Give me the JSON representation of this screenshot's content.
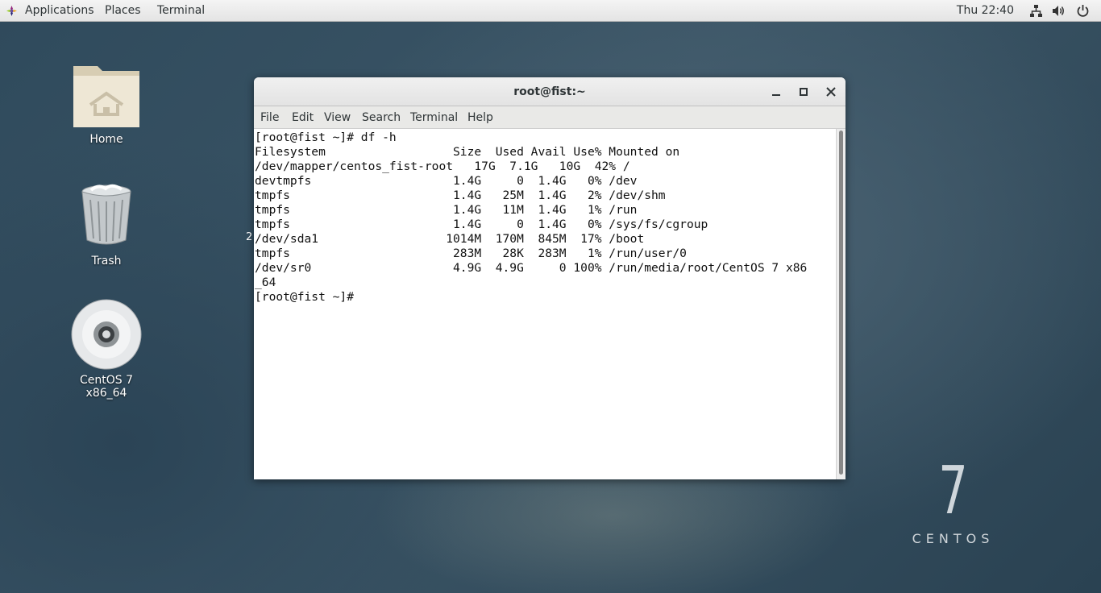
{
  "topbar": {
    "applications": "Applications",
    "places": "Places",
    "terminal": "Terminal",
    "clock": "Thu 22:40",
    "tray_icons": [
      "network-icon",
      "volume-icon",
      "power-icon"
    ]
  },
  "desktop": {
    "home_label": "Home",
    "trash_label": "Trash",
    "disc_label": "CentOS 7 x86_64",
    "stray_char": "2",
    "logo_number": "7",
    "logo_word": "CENTOS"
  },
  "window": {
    "title": "root@fist:~",
    "menu": [
      "File",
      "Edit",
      "View",
      "Search",
      "Terminal",
      "Help"
    ],
    "terminal_lines": [
      "[root@fist ~]# df -h",
      "Filesystem                  Size  Used Avail Use% Mounted on",
      "/dev/mapper/centos_fist-root   17G  7.1G   10G  42% /",
      "devtmpfs                    1.4G     0  1.4G   0% /dev",
      "tmpfs                       1.4G   25M  1.4G   2% /dev/shm",
      "tmpfs                       1.4G   11M  1.4G   1% /run",
      "tmpfs                       1.4G     0  1.4G   0% /sys/fs/cgroup",
      "/dev/sda1                  1014M  170M  845M  17% /boot",
      "tmpfs                       283M   28K  283M   1% /run/user/0",
      "/dev/sr0                    4.9G  4.9G     0 100% /run/media/root/CentOS 7 x86",
      "_64",
      "[root@fist ~]#"
    ]
  },
  "colors": {
    "topbar_bg": "#ececec",
    "terminal_bg": "#ffffff",
    "terminal_fg": "#111111"
  }
}
